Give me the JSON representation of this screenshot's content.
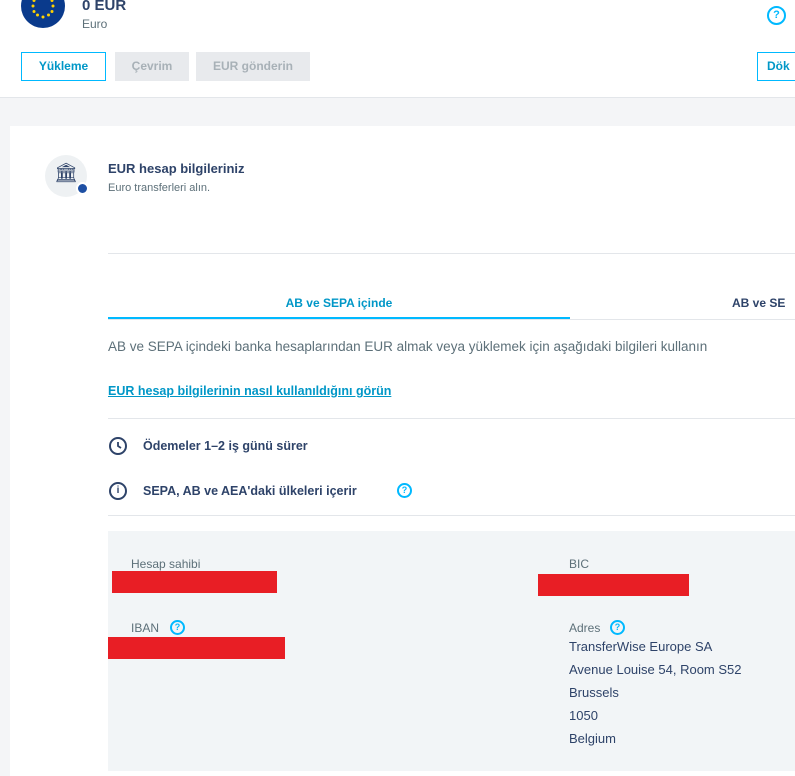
{
  "balance": {
    "amount": "0 EUR",
    "currency": "Euro"
  },
  "toolbar": {
    "load_label": "Yükleme",
    "convert_label": "Çevrim",
    "send_label": "EUR gönderin",
    "right_label": "Dök"
  },
  "help_icon": "question-circle-icon",
  "section": {
    "title": "EUR hesap bilgileriniz",
    "subtitle": "Euro transferleri alın."
  },
  "tabs": [
    {
      "label": "AB ve SEPA içinde",
      "active": true
    },
    {
      "label": "AB ve SE",
      "active": false
    }
  ],
  "description": "AB ve SEPA içindeki banka hesaplarından EUR almak veya yüklemek için aşağıdaki bilgileri kullanın",
  "howto_link": "EUR hesap bilgilerinin nasıl kullanıldığını görün",
  "info": [
    {
      "icon": "clock-icon",
      "text": "Ödemeler 1–2 iş günü sürer"
    },
    {
      "icon": "info-icon",
      "text": "SEPA, AB ve AEA'daki ülkeleri içerir"
    }
  ],
  "details": {
    "holder_label": "Hesap sahibi",
    "bic_label": "BIC",
    "iban_label": "IBAN",
    "address_label": "Adres",
    "address_lines": [
      "TransferWise Europe SA",
      "Avenue Louise 54, Room S52",
      "Brussels",
      "1050",
      "Belgium"
    ]
  },
  "colors": {
    "accent": "#00b9ff",
    "link": "#0097c7",
    "text": "#2e4369",
    "redaction": "#e81e25",
    "flag": "#0a3a8c"
  }
}
